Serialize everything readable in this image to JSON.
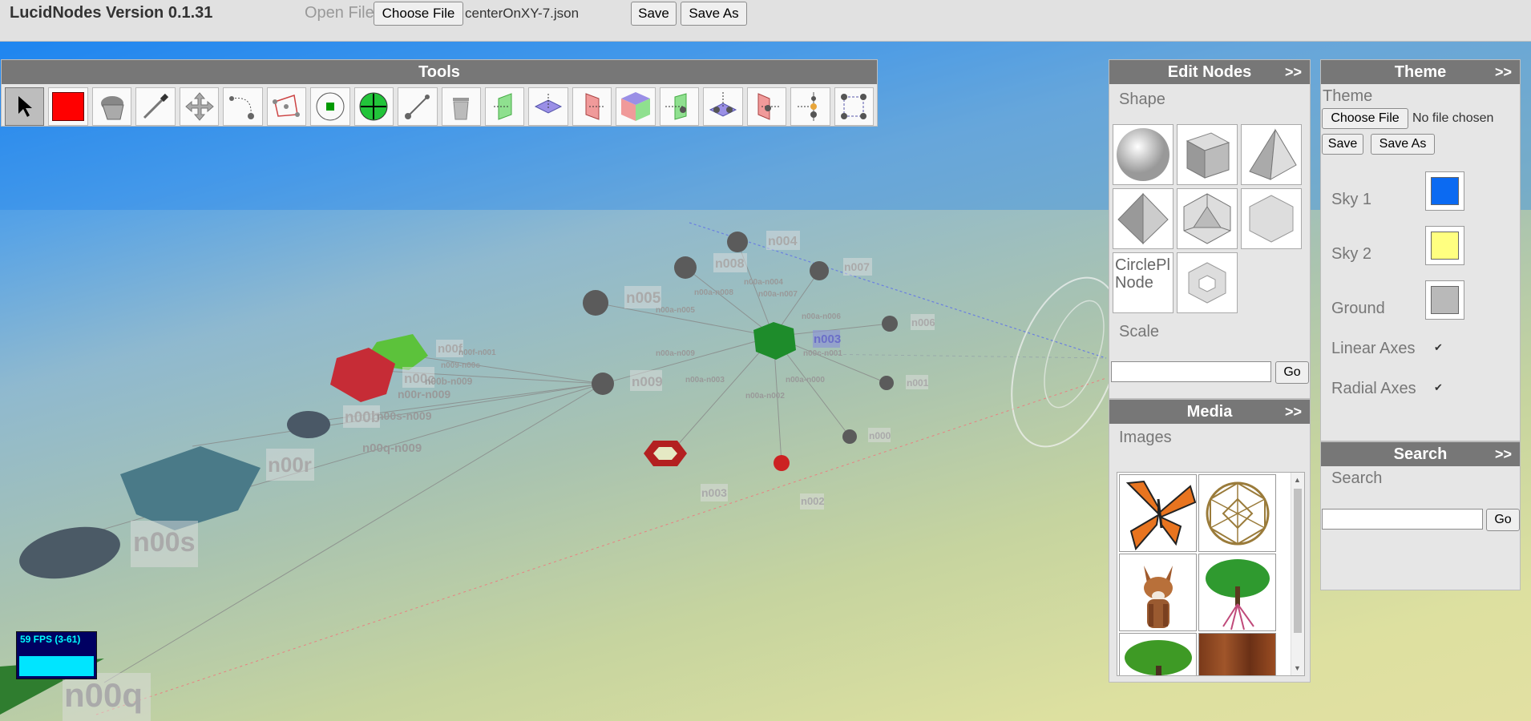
{
  "app": {
    "title": "LucidNodes Version 0.1.31"
  },
  "top_bar": {
    "open_file_label": "Open File",
    "choose_file_label": "Choose File",
    "file_name": "centerOnXY-7.json",
    "save_label": "Save",
    "save_as_label": "Save As"
  },
  "tools": {
    "title": "Tools",
    "items": [
      {
        "icon": "cursor-icon",
        "active": true
      },
      {
        "icon": "color-swatch-icon"
      },
      {
        "icon": "paint-bucket-icon"
      },
      {
        "icon": "eyedropper-icon"
      },
      {
        "icon": "move-arrows-icon"
      },
      {
        "icon": "curved-path-icon"
      },
      {
        "icon": "polygon-select-icon"
      },
      {
        "icon": "add-node-circle-icon"
      },
      {
        "icon": "add-node-plus-icon"
      },
      {
        "icon": "link-line-icon"
      },
      {
        "icon": "trash-icon"
      },
      {
        "icon": "plane-xz-icon"
      },
      {
        "icon": "plane-xy-icon"
      },
      {
        "icon": "plane-yz-icon"
      },
      {
        "icon": "cube-planes-icon"
      },
      {
        "icon": "center-plane-green-icon"
      },
      {
        "icon": "center-plane-blue-icon"
      },
      {
        "icon": "center-plane-red-icon"
      },
      {
        "icon": "align-vertical-icon"
      },
      {
        "icon": "group-select-icon"
      }
    ]
  },
  "edit_nodes": {
    "title": "Edit Nodes",
    "expand": ">>",
    "shape_label": "Shape",
    "shapes": [
      "sphere-shape-icon",
      "cube-shape-icon",
      "tetrahedron-shape-icon",
      "octahedron-shape-icon",
      "icosahedron-shape-icon",
      "hexagon-shape-icon"
    ],
    "broken_image_text": "CirclePl Node",
    "scale_label": "Scale",
    "scale_value": "",
    "go_label": "Go"
  },
  "media": {
    "title": "Media",
    "expand": ">>",
    "images_label": "Images",
    "images": [
      "butterfly-image",
      "geodesic-sphere-image",
      "fox-image",
      "tree-with-roots-image",
      "tree-image",
      "wood-texture-image"
    ]
  },
  "theme": {
    "title": "Theme",
    "expand": ">>",
    "label": "Theme",
    "choose_file_label": "Choose File",
    "no_file_text": "No file chosen",
    "save_label": "Save",
    "save_as_label": "Save As",
    "sky1_label": "Sky 1",
    "sky1_color": "#0b6af2",
    "sky2_label": "Sky 2",
    "sky2_color": "#ffff80",
    "ground_label": "Ground",
    "ground_color": "#b9b9b9",
    "linear_axes_label": "Linear Axes",
    "linear_axes_checked": true,
    "radial_axes_label": "Radial Axes",
    "radial_axes_checked": true
  },
  "search": {
    "title": "Search",
    "expand": ">>",
    "label": "Search",
    "value": "",
    "go_label": "Go"
  },
  "fps": {
    "text": "59 FPS (3-61)"
  },
  "scene": {
    "node_labels": [
      "n004",
      "n008",
      "n007",
      "n005",
      "n006",
      "n003",
      "n009",
      "n001",
      "n000",
      "n003",
      "n002",
      "n00f",
      "n00c",
      "n00b",
      "n00r",
      "n00s",
      "n00q"
    ],
    "edge_labels": [
      "n00a-n004",
      "n00a-n008",
      "n00a-n007",
      "n00a-n005",
      "n00a-n006",
      "n00a-n009",
      "n00c-n001",
      "n00a-n003",
      "n00a-n000",
      "n00a-n002",
      "n00f-n001",
      "n009-n00c",
      "n00b-n009",
      "n00r-n009",
      "n00s-n009",
      "n00q-n009"
    ]
  }
}
